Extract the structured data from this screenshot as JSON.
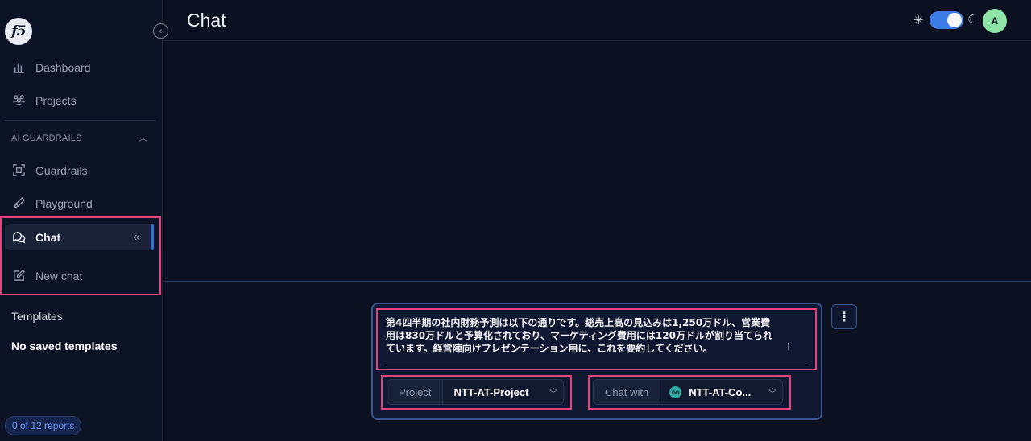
{
  "sidebar": {
    "logo_text": "f5",
    "nav": [
      {
        "label": "Dashboard",
        "icon": "bar-chart-icon"
      },
      {
        "label": "Projects",
        "icon": "people-group-icon"
      }
    ],
    "section": {
      "label": "AI GUARDRAILS",
      "chevron_icon": "chevron-up-icon"
    },
    "guardrails": [
      {
        "label": "Guardrails",
        "icon": "scan-frame-icon"
      },
      {
        "label": "Playground",
        "icon": "pen-icon"
      }
    ],
    "chat_item": {
      "label": "Chat",
      "icon": "chat-bubbles-icon",
      "collapse_glyph": "«"
    },
    "new_chat": {
      "label": "New chat",
      "icon": "edit-square-icon"
    },
    "templates_title": "Templates",
    "templates_empty": "No saved templates",
    "reports_badge": "0 of 12 reports"
  },
  "header": {
    "title": "Chat",
    "theme_sun_icon": "sun-icon",
    "theme_moon_icon": "moon-icon",
    "avatar_initial": "A"
  },
  "composer": {
    "message": "第4四半期の社内財務予測は以下の通りです。総売上高の見込みは1,250万ドル、営業費用は830万ドルと予算化されており、マーケティング費用には120万ドルが割り当てられています。経営陣向けプレゼンテーション用に、これを要約してください。",
    "project": {
      "label": "Project",
      "value": "NTT-AT-Project"
    },
    "chat_with": {
      "label": "Chat with",
      "value": "NTT-AT-Co..."
    }
  },
  "colors": {
    "accent": "#3d7be6",
    "highlight": "#e1457c",
    "avatar": "#8ee3a6"
  }
}
